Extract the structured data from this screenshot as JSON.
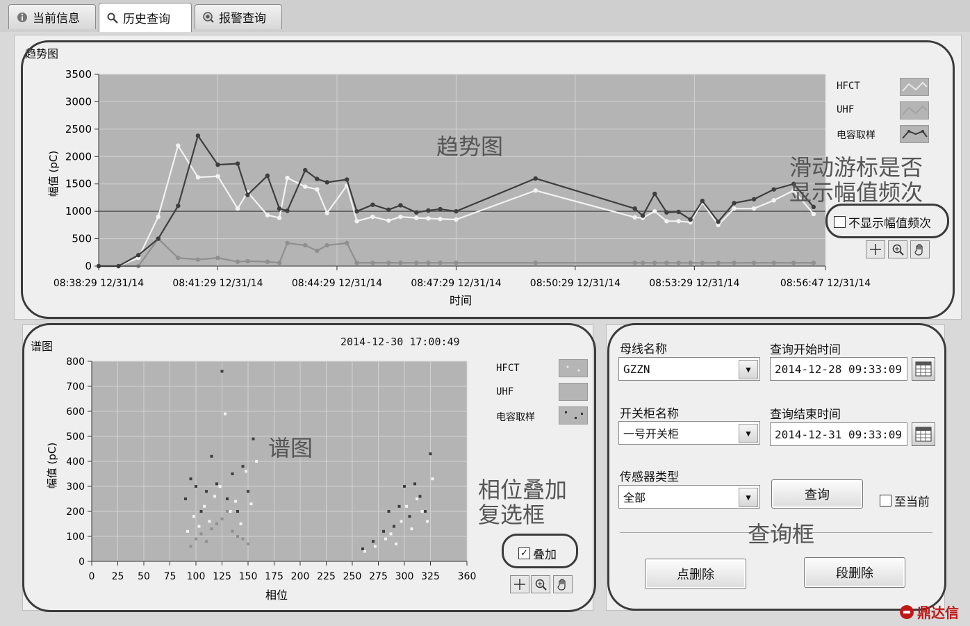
{
  "tabs": [
    {
      "label": "当前信息",
      "icon": "info-icon"
    },
    {
      "label": "历史查询",
      "icon": "search-icon"
    },
    {
      "label": "报警查询",
      "icon": "alarm-search-icon"
    }
  ],
  "trend": {
    "section_label": "趋势图",
    "overlay_label": "趋势图",
    "legend": [
      "HFCT",
      "UHF",
      "电容取样"
    ],
    "cursor_callout_line1": "滑动游标是否",
    "cursor_callout_line2": "显示幅值频次",
    "checkbox_label": "不显示幅值频次",
    "checkbox_checked": false
  },
  "spectrum": {
    "section_label": "谱图",
    "timestamp": "2014-12-30  17:00:49",
    "overlay_label": "谱图",
    "legend": [
      "HFCT",
      "UHF",
      "电容取样"
    ],
    "callout_line1": "相位叠加",
    "callout_line2": "复选框",
    "checkbox_label": "叠加",
    "checkbox_checked": true
  },
  "query": {
    "bus_label": "母线名称",
    "bus_value": "GZZN",
    "start_label": "查询开始时间",
    "start_value": "2014-12-28  09:33:09",
    "cabinet_label": "开关柜名称",
    "cabinet_value": "一号开关柜",
    "end_label": "查询结束时间",
    "end_value": "2014-12-31  09:33:09",
    "sensor_label": "传感器类型",
    "sensor_value": "全部",
    "query_button": "查询",
    "to_now_label": "至当前",
    "to_now_checked": false,
    "overlay_label": "查询框",
    "point_delete_button": "点删除",
    "segment_delete_button": "段删除"
  },
  "watermark": "鼎达信",
  "colors": {
    "plot_bg": "#b4b4b4",
    "grid": "#dcdcdc",
    "dark_series": "#3e3e3e",
    "light_series": "#f2f2f2",
    "mid_series": "#8f8f8f",
    "threshold": "#555555"
  },
  "chart_data": [
    {
      "type": "line",
      "title": "",
      "xlabel": "时间",
      "ylabel": "幅值 (pC)",
      "ylim": [
        0,
        3500
      ],
      "yticks": [
        0,
        500,
        1000,
        1500,
        2000,
        2500,
        3000,
        3500
      ],
      "x_tick_labels": [
        "08:38:29 12/31/14",
        "08:41:29 12/31/14",
        "08:44:29 12/31/14",
        "08:47:29 12/31/14",
        "08:50:29 12/31/14",
        "08:53:29 12/31/14",
        "08:56:47 12/31/14"
      ],
      "x_unit": "minutes after 08:38:29",
      "xlim": [
        0,
        18.3
      ],
      "threshold": 1000,
      "legend_position": "right",
      "grid": true,
      "series": [
        {
          "name": "电容取样",
          "color": "#3e3e3e",
          "x": [
            0,
            0.5,
            1.0,
            1.5,
            2.0,
            2.5,
            3.0,
            3.5,
            3.75,
            4.25,
            4.55,
            4.75,
            5.2,
            5.5,
            5.75,
            6.25,
            6.5,
            6.9,
            7.3,
            7.6,
            8,
            8.3,
            8.6,
            9,
            11,
            13.5,
            13.7,
            14,
            14.3,
            14.6,
            14.9,
            15.2,
            15.6,
            16,
            16.5,
            17,
            17.5,
            18
          ],
          "y": [
            0,
            0,
            200,
            500,
            1100,
            2380,
            1850,
            1870,
            1300,
            1650,
            1050,
            1010,
            1750,
            1590,
            1530,
            1580,
            1000,
            1120,
            1030,
            1110,
            980,
            1015,
            1040,
            1000,
            1600,
            1050,
            920,
            1320,
            980,
            990,
            850,
            1190,
            810,
            1150,
            1220,
            1400,
            1500,
            1080
          ]
        },
        {
          "name": "HFCT",
          "color": "#f2f2f2",
          "x": [
            0,
            0.5,
            1.0,
            1.5,
            2.0,
            2.5,
            3.0,
            3.5,
            3.75,
            4.25,
            4.55,
            4.75,
            5.2,
            5.5,
            5.75,
            6.25,
            6.5,
            6.9,
            7.3,
            7.6,
            8,
            8.3,
            8.6,
            9,
            11,
            13.5,
            13.7,
            14,
            14.3,
            14.6,
            14.9,
            15.2,
            15.6,
            16,
            16.5,
            17,
            17.5,
            18
          ],
          "y": [
            0,
            0,
            150,
            900,
            2200,
            1620,
            1640,
            1050,
            1350,
            930,
            880,
            1610,
            1450,
            1400,
            970,
            1470,
            820,
            900,
            830,
            900,
            880,
            870,
            860,
            850,
            1380,
            890,
            880,
            1000,
            820,
            820,
            800,
            1160,
            750,
            1050,
            1050,
            1200,
            1380,
            950
          ]
        },
        {
          "name": "UHF",
          "color": "#8f8f8f",
          "x": [
            0,
            0.5,
            1.0,
            1.5,
            2.0,
            2.5,
            3.0,
            3.5,
            3.75,
            4.25,
            4.55,
            4.75,
            5.2,
            5.5,
            5.75,
            6.25,
            6.5,
            6.9,
            7.3,
            7.6,
            8,
            8.3,
            8.6,
            9,
            11,
            13.5,
            13.7,
            14,
            14.3,
            14.6,
            14.9,
            15.2,
            15.6,
            16,
            16.5,
            17,
            17.5,
            18
          ],
          "y": [
            0,
            0,
            0,
            500,
            150,
            120,
            150,
            80,
            90,
            80,
            60,
            420,
            380,
            280,
            380,
            420,
            60,
            60,
            60,
            60,
            60,
            60,
            60,
            60,
            60,
            60,
            60,
            60,
            60,
            60,
            60,
            60,
            60,
            60,
            60,
            60,
            60,
            60
          ]
        }
      ]
    },
    {
      "type": "scatter",
      "title": "",
      "xlabel": "相位",
      "ylabel": "幅值 (pC)",
      "xlim": [
        0,
        360
      ],
      "ylim": [
        0,
        800
      ],
      "xticks": [
        0,
        25,
        50,
        75,
        100,
        125,
        150,
        175,
        200,
        225,
        250,
        275,
        300,
        325,
        360
      ],
      "yticks": [
        0,
        100,
        200,
        300,
        400,
        500,
        600,
        700,
        800
      ],
      "legend_position": "right",
      "grid": true,
      "series": [
        {
          "name": "电容取样",
          "color": "#3e3e3e",
          "x": [
            90,
            95,
            100,
            105,
            110,
            115,
            120,
            125,
            130,
            135,
            140,
            145,
            150,
            155,
            260,
            270,
            280,
            285,
            290,
            295,
            300,
            305,
            310,
            315,
            320,
            325
          ],
          "y": [
            250,
            330,
            300,
            200,
            280,
            420,
            310,
            760,
            250,
            350,
            200,
            380,
            280,
            490,
            50,
            80,
            120,
            200,
            140,
            220,
            300,
            180,
            310,
            260,
            200,
            430
          ]
        },
        {
          "name": "HFCT",
          "color": "#f2f2f2",
          "x": [
            92,
            98,
            103,
            108,
            113,
            118,
            123,
            128,
            133,
            138,
            143,
            148,
            153,
            158,
            262,
            272,
            282,
            287,
            292,
            297,
            302,
            307,
            312,
            317,
            322,
            327
          ],
          "y": [
            120,
            180,
            140,
            220,
            160,
            260,
            300,
            590,
            200,
            240,
            150,
            360,
            230,
            400,
            40,
            60,
            90,
            110,
            70,
            160,
            220,
            130,
            250,
            200,
            160,
            330
          ]
        },
        {
          "name": "UHF",
          "color": "#8f8f8f",
          "x": [
            95,
            100,
            105,
            110,
            115,
            120,
            125,
            130,
            135,
            140,
            145,
            150
          ],
          "y": [
            60,
            90,
            110,
            80,
            130,
            150,
            170,
            200,
            120,
            100,
            90,
            70
          ]
        }
      ]
    }
  ]
}
